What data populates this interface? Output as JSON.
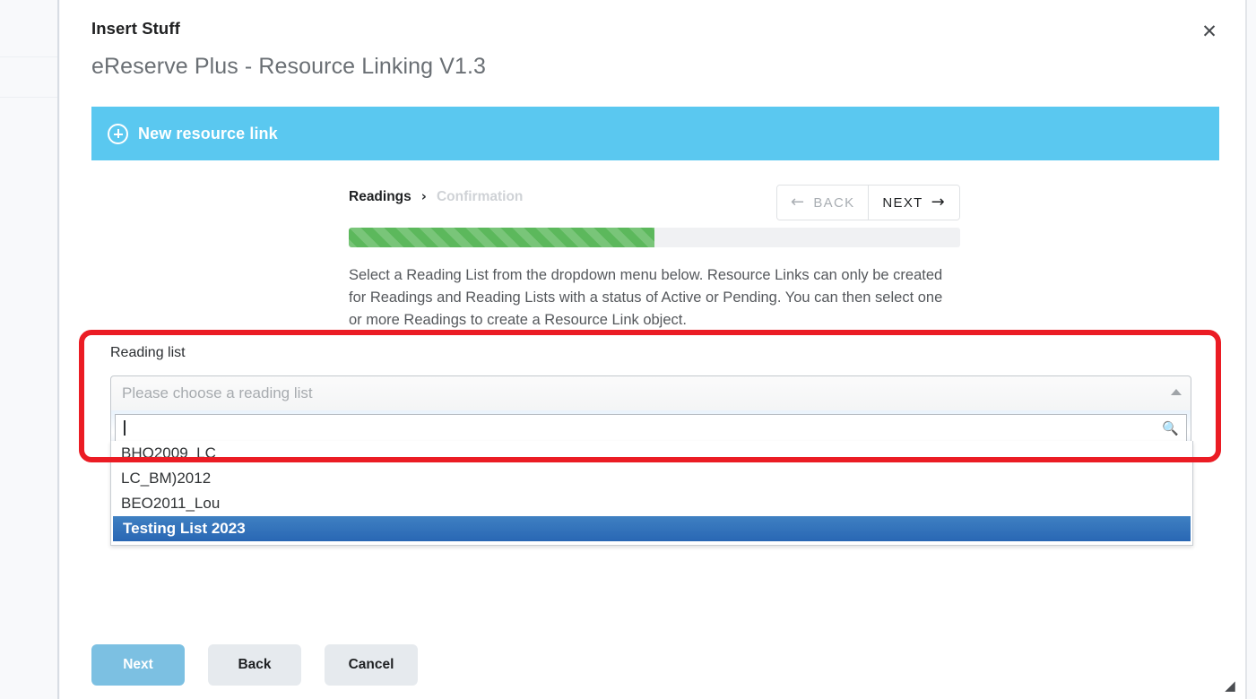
{
  "window": {
    "title": "Insert Stuff",
    "subtitle": "eReserve Plus - Resource Linking V1.3",
    "close_icon": "close-icon",
    "resize_grip_icon": "resize-grip-icon"
  },
  "banner": {
    "icon": "plus-circle-icon",
    "label": "New resource link",
    "color": "#5ac8f0"
  },
  "wizard": {
    "steps": [
      {
        "label": "Readings",
        "state": "active"
      },
      {
        "label": "Confirmation",
        "state": "inactive"
      }
    ],
    "chevron": "›",
    "nav": {
      "back_label": "BACK",
      "back_arrow": "←",
      "next_label": "NEXT",
      "next_arrow": "→"
    },
    "progress": {
      "percent": 50,
      "fill_color": "#5cb85c",
      "track_color": "#f0f1f3"
    },
    "description": "Select a Reading List from the dropdown menu below. Resource Links can only be created for Readings and Reading Lists with a status of Active or Pending. You can then select one or more Readings to create a Resource Link object."
  },
  "form": {
    "field_label": "Reading list",
    "select": {
      "placeholder": "Please choose a reading list",
      "caret_icon": "chevron-up-icon",
      "search_value": "",
      "search_icon": "search-icon",
      "options": [
        {
          "label": "BHO2009_LC",
          "selected": false
        },
        {
          "label": "LC_BM)2012",
          "selected": false
        },
        {
          "label": "BEO2011_Lou",
          "selected": false
        },
        {
          "label": "Testing List 2023",
          "selected": true
        }
      ],
      "highlight_color": "#2967b4"
    }
  },
  "annotation": {
    "shape": "rounded-rectangle",
    "color": "#eb1c24"
  },
  "footer": {
    "buttons": [
      {
        "label": "Next",
        "style": "primary"
      },
      {
        "label": "Back",
        "style": "plain"
      },
      {
        "label": "Cancel",
        "style": "plain"
      }
    ]
  }
}
